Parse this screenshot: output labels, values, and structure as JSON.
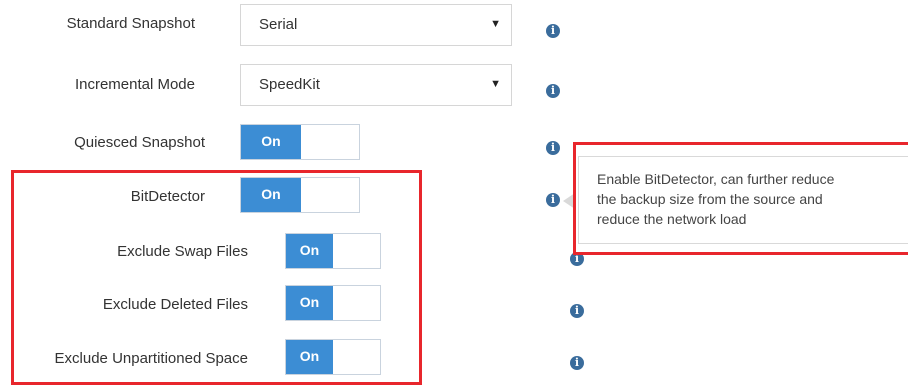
{
  "settings": {
    "standard_snapshot": {
      "label": "Standard Snapshot",
      "value": "Serial"
    },
    "incremental_mode": {
      "label": "Incremental Mode",
      "value": "SpeedKit"
    },
    "quiesced_snapshot": {
      "label": "Quiesced Snapshot",
      "state": "On"
    },
    "bitdetector": {
      "label": "BitDetector",
      "state": "On"
    },
    "exclude_swap": {
      "label": "Exclude Swap Files",
      "state": "On"
    },
    "exclude_deleted": {
      "label": "Exclude Deleted Files",
      "state": "On"
    },
    "exclude_unpartitioned": {
      "label": "Exclude Unpartitioned Space",
      "state": "On"
    }
  },
  "tooltip": {
    "lines": [
      "Enable BitDetector, can further reduce",
      "the backup size from the source and",
      "reduce the network load"
    ]
  },
  "icons": {
    "info": "info-icon",
    "caret": "caret-down-icon"
  },
  "colors": {
    "toggle_on": "#3c8dd4",
    "highlight": "#e8262c",
    "info": "#3a6c9c"
  }
}
